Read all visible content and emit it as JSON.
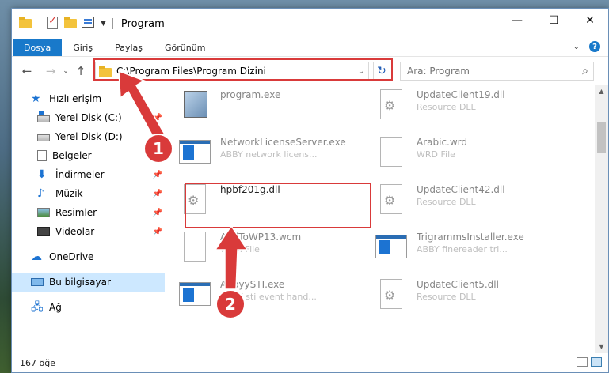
{
  "window": {
    "title": "Program",
    "controls": {
      "minimize": "—",
      "maximize": "☐",
      "close": "✕"
    }
  },
  "ribbon": {
    "tabs": [
      "Dosya",
      "Giriş",
      "Paylaş",
      "Görünüm"
    ],
    "active_tab": "Dosya"
  },
  "navigation": {
    "back": "←",
    "forward": "→",
    "recent": "⌄",
    "up": "↑",
    "address": "C:\\Program Files\\Program Dizini",
    "refresh": "↻",
    "search_placeholder": "Ara: Program",
    "search_icon": "search-icon"
  },
  "sidebar": {
    "items": [
      {
        "label": "Hızlı erişim",
        "icon": "star-icon",
        "pinned": false
      },
      {
        "label": "Yerel Disk (C:)",
        "icon": "drive-icon",
        "pinned": true
      },
      {
        "label": "Yerel Disk (D:)",
        "icon": "drive-icon",
        "pinned": false
      },
      {
        "label": "Belgeler",
        "icon": "documents-icon",
        "pinned": false
      },
      {
        "label": "İndirmeler",
        "icon": "download-icon",
        "pinned": true
      },
      {
        "label": "Müzik",
        "icon": "music-icon",
        "pinned": true
      },
      {
        "label": "Resimler",
        "icon": "pictures-icon",
        "pinned": true
      },
      {
        "label": "Videolar",
        "icon": "videos-icon",
        "pinned": true
      },
      {
        "label": "OneDrive",
        "icon": "cloud-icon",
        "pinned": false
      },
      {
        "label": "Bu bilgisayar",
        "icon": "computer-icon",
        "pinned": false,
        "selected": true
      },
      {
        "label": "Ağ",
        "icon": "network-icon",
        "pinned": false
      }
    ],
    "pin_glyph": "📌"
  },
  "files": [
    {
      "name": "program.exe",
      "desc": "",
      "icon": "exe-icon"
    },
    {
      "name": "UpdateClient19.dll",
      "desc": "Resource DLL",
      "icon": "dll-icon"
    },
    {
      "name": "NetworkLicenseServer.exe",
      "desc": "ABBY network licens...",
      "icon": "app-window-icon"
    },
    {
      "name": "Arabic.wrd",
      "desc": "WRD File",
      "icon": "file-icon"
    },
    {
      "name": "hpbf201g.dll",
      "desc": "",
      "icon": "dll-icon"
    },
    {
      "name": "UpdateClient42.dll",
      "desc": "Resource DLL",
      "icon": "dll-icon"
    },
    {
      "name": "AddToWP13.wcm",
      "desc": "WCM File",
      "icon": "file-icon"
    },
    {
      "name": "TrigrammsInstaller.exe",
      "desc": "ABBY finereader tri...",
      "icon": "app-window-icon"
    },
    {
      "name": "AbbyySTI.exe",
      "desc": "ABBY sti event hand...",
      "icon": "app-window-icon"
    },
    {
      "name": "UpdateClient5.dll",
      "desc": "Resource DLL",
      "icon": "dll-icon"
    }
  ],
  "status": {
    "item_count": "167 öğe"
  },
  "annotations": {
    "callout_1": "1",
    "callout_2": "2",
    "color": "#d93a3a"
  },
  "colors": {
    "accent": "#1979ca",
    "selection": "#cde8ff"
  }
}
